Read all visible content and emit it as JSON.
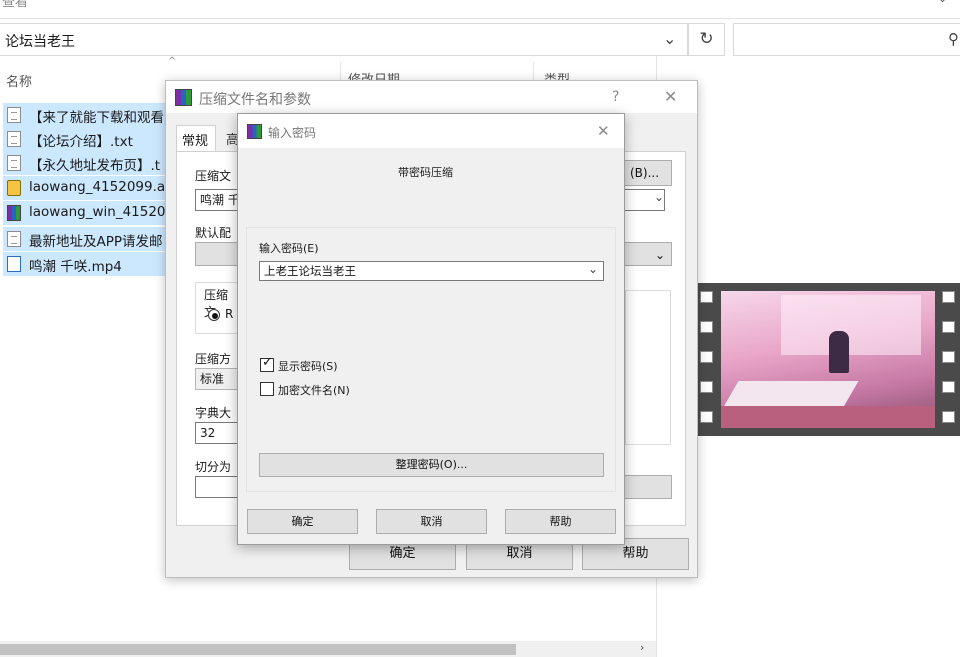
{
  "explorer": {
    "ribbon_cut": "查看",
    "address_text": "论坛当老王",
    "col_name": "名称",
    "col_date": "修改日期",
    "col_type": "类型",
    "files": [
      {
        "name": "【来了就能下载和观看",
        "icon": "text-file-icon"
      },
      {
        "name": "【论坛介绍】.txt",
        "icon": "text-file-icon"
      },
      {
        "name": "【永久地址发布页】.t",
        "icon": "text-file-icon"
      },
      {
        "name": "laowang_4152099.a",
        "icon": "apk-file-icon"
      },
      {
        "name": "laowang_win_41520",
        "icon": "rar-file-icon"
      },
      {
        "name": "最新地址及APP请发邮",
        "icon": "text-file-icon"
      },
      {
        "name": "鸣潮 千咲.mp4",
        "icon": "video-file-icon"
      }
    ]
  },
  "archive_dialog": {
    "title": "压缩文件名和参数",
    "help_glyph": "?",
    "close_glyph": "✕",
    "tab_general": "常规",
    "tab_advanced": "高",
    "archive_name_label": "压缩文",
    "archive_name_value": "鸣潮 千",
    "browse_label": "(B)...",
    "default_profile_label": "默认配",
    "format_label": "压缩文",
    "format_option": "R",
    "method_label": "压缩方",
    "method_value": "标准",
    "dict_label": "字典大",
    "dict_value": "32",
    "split_label": "切分为",
    "ok": "确定",
    "cancel": "取消",
    "help": "帮助"
  },
  "password_dialog": {
    "title": "输入密码",
    "close_glyph": "✕",
    "heading": "带密码压缩",
    "password_label": "输入密码(E)",
    "password_value": "上老王论坛当老王",
    "show_password_label": "显示密码(S)",
    "show_password_checked": true,
    "encrypt_names_label": "加密文件名(N)",
    "encrypt_names_checked": false,
    "organize_button": "整理密码(O)...",
    "ok": "确定",
    "cancel": "取消",
    "help": "帮助"
  },
  "colors": {
    "selection": "#cce8ff",
    "dialog_bg": "#f0f0f0",
    "button_bg": "#e1e1e1",
    "film_strip": "#4a4a4a"
  }
}
